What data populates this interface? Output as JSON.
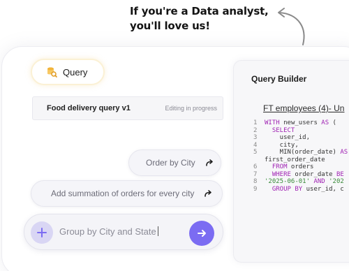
{
  "headline": {
    "line1": "If you're a Data analyst,",
    "line2": "you'll love us!"
  },
  "query_tab": {
    "label": "Query",
    "icon": "database-search-icon"
  },
  "query_name": {
    "title": "Food delivery query v1",
    "status": "Editing in progress"
  },
  "suggestions": [
    {
      "label": "Order by City",
      "icon": "forward-arrow-icon"
    },
    {
      "label": "Add summation of orders for every city",
      "icon": "forward-arrow-icon"
    }
  ],
  "composer": {
    "value": "Group by City and State",
    "add_icon": "plus-icon",
    "send_icon": "arrow-right-icon"
  },
  "builder": {
    "title": "Query Builder",
    "subtitle": "FT employees (4)- Un",
    "code_lines": [
      {
        "n": "1",
        "parts": [
          {
            "k": "kw",
            "t": "WITH"
          },
          {
            "k": "t",
            "t": " new_users "
          },
          {
            "k": "kw",
            "t": "AS"
          },
          {
            "k": "t",
            "t": " ("
          }
        ]
      },
      {
        "n": "2",
        "parts": [
          {
            "k": "kw",
            "t": "  SELECT"
          }
        ]
      },
      {
        "n": "3",
        "parts": [
          {
            "k": "t",
            "t": "    user_id,"
          }
        ]
      },
      {
        "n": "4",
        "parts": [
          {
            "k": "t",
            "t": "    city,"
          }
        ]
      },
      {
        "n": "5",
        "parts": [
          {
            "k": "t",
            "t": "    MIN(order_date) "
          },
          {
            "k": "kw",
            "t": "AS"
          }
        ]
      },
      {
        "n": "",
        "parts": [
          {
            "k": "t",
            "t": "first_order_date"
          }
        ]
      },
      {
        "n": "6",
        "parts": [
          {
            "k": "kw",
            "t": "  FROM"
          },
          {
            "k": "t",
            "t": " orders"
          }
        ]
      },
      {
        "n": "7",
        "parts": [
          {
            "k": "kw",
            "t": "  WHERE"
          },
          {
            "k": "t",
            "t": " order_date "
          },
          {
            "k": "kw",
            "t": "BE"
          }
        ]
      },
      {
        "n": "8",
        "parts": [
          {
            "k": "str",
            "t": "'2025-06-01'"
          },
          {
            "k": "t",
            "t": " "
          },
          {
            "k": "kw",
            "t": "AND"
          },
          {
            "k": "t",
            "t": " "
          },
          {
            "k": "str",
            "t": "'202"
          }
        ]
      },
      {
        "n": "9",
        "parts": [
          {
            "k": "kw",
            "t": "  GROUP BY"
          },
          {
            "k": "t",
            "t": " user_id, c"
          }
        ]
      }
    ]
  },
  "colors": {
    "accent": "#7b6cf2",
    "accent_light": "#d9d6f4",
    "keyword": "#a024b4",
    "string": "#3a8a3a",
    "query_pill_border": "#fbf1d5"
  }
}
